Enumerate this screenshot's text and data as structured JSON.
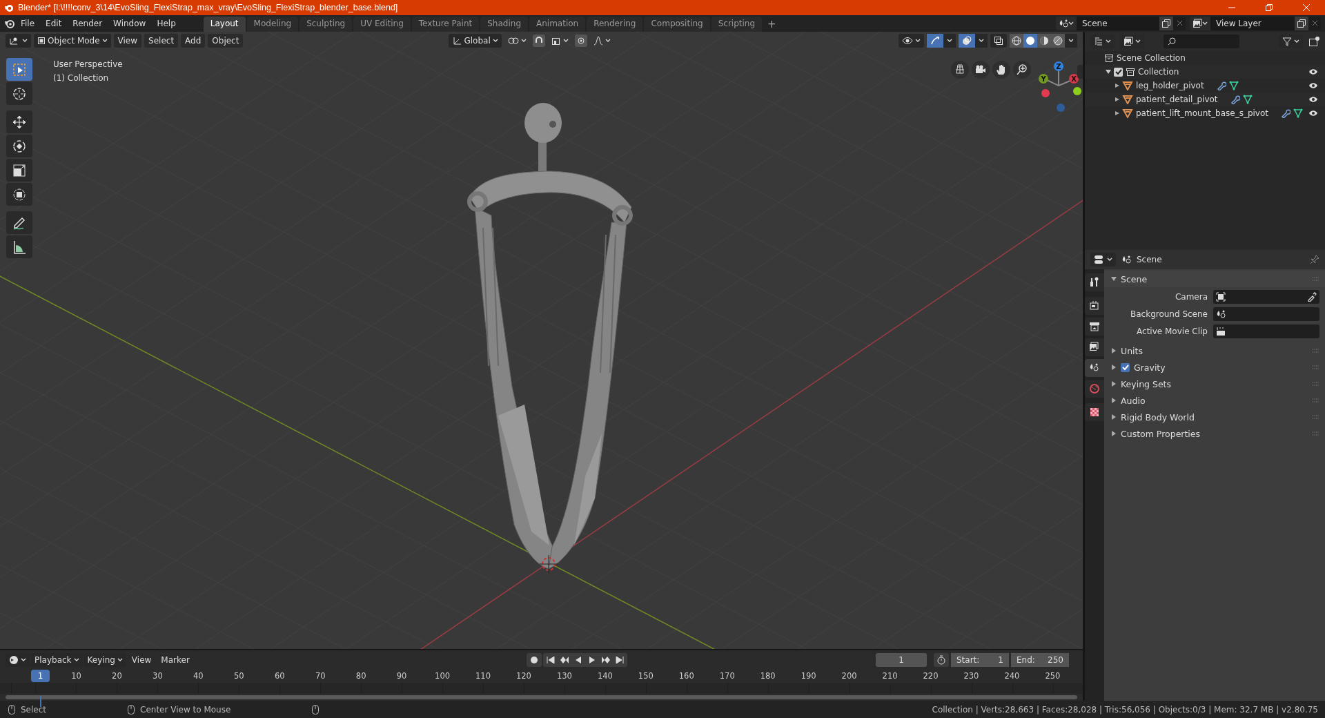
{
  "window": {
    "title": "Blender* [I:\\!!!!conv_3\\14\\EvoSling_FlexiStrap_max_vray\\EvoSling_FlexiStrap_blender_base.blend]"
  },
  "menu": [
    "File",
    "Edit",
    "Render",
    "Window",
    "Help"
  ],
  "workspaces": [
    {
      "label": "Layout",
      "selected": true
    },
    {
      "label": "Modeling",
      "selected": false
    },
    {
      "label": "Sculpting",
      "selected": false
    },
    {
      "label": "UV Editing",
      "selected": false
    },
    {
      "label": "Texture Paint",
      "selected": false
    },
    {
      "label": "Shading",
      "selected": false
    },
    {
      "label": "Animation",
      "selected": false
    },
    {
      "label": "Rendering",
      "selected": false
    },
    {
      "label": "Compositing",
      "selected": false
    },
    {
      "label": "Scripting",
      "selected": false
    }
  ],
  "add_workspace": "+",
  "scene_selector": {
    "value": "Scene"
  },
  "view_layer_selector": {
    "value": "View Layer"
  },
  "viewport": {
    "mode": "Object Mode",
    "menus": [
      "View",
      "Select",
      "Add",
      "Object"
    ],
    "orientation": "Global",
    "shading": [
      {
        "kind": "wireframe",
        "selected": false
      },
      {
        "kind": "solid",
        "selected": true
      },
      {
        "kind": "material",
        "selected": false
      },
      {
        "kind": "rendered",
        "selected": false
      }
    ],
    "overlay_text": [
      "User Perspective",
      "(1) Collection"
    ],
    "tools": [
      {
        "kind": "select",
        "selected": true
      },
      {
        "kind": "cursor",
        "selected": false
      },
      {
        "kind": "move",
        "selected": false
      },
      {
        "kind": "rotate",
        "selected": false
      },
      {
        "kind": "scale",
        "selected": false
      },
      {
        "kind": "transform",
        "selected": false
      },
      {
        "kind": "annotate",
        "selected": false
      },
      {
        "kind": "measure",
        "selected": false
      }
    ],
    "gizmo_axes": [
      "Z",
      "Y",
      "X"
    ]
  },
  "outliner": {
    "root": "Scene Collection",
    "items": [
      {
        "label": "Collection",
        "checked": true,
        "expanded": true,
        "children": [
          {
            "label": "leg_holder_pivot"
          },
          {
            "label": "patient_detail_pivot"
          },
          {
            "label": "patient_lift_mount_base_s_pivot"
          }
        ]
      }
    ]
  },
  "properties": {
    "context": "Scene",
    "tabs": [
      {
        "kind": "tool",
        "selected": false
      },
      {
        "kind": "render",
        "selected": false
      },
      {
        "kind": "output",
        "selected": false
      },
      {
        "kind": "view_layer",
        "selected": false
      },
      {
        "kind": "scene",
        "selected": true
      },
      {
        "kind": "world",
        "selected": false
      },
      {
        "kind": "texture",
        "selected": false
      }
    ],
    "panels": [
      {
        "kind": "plain",
        "label": "Scene",
        "expanded": true,
        "fields": [
          {
            "kind": "camera",
            "label": "Camera"
          },
          {
            "kind": "scene",
            "label": "Background Scene"
          },
          {
            "kind": "clip",
            "label": "Active Movie Clip"
          }
        ]
      },
      {
        "kind": "plain",
        "label": "Units",
        "expanded": false
      },
      {
        "kind": "check",
        "label": "Gravity",
        "expanded": false,
        "checked": true
      },
      {
        "kind": "plain",
        "label": "Keying Sets",
        "expanded": false
      },
      {
        "kind": "plain",
        "label": "Audio",
        "expanded": false
      },
      {
        "kind": "plain",
        "label": "Rigid Body World",
        "expanded": false
      },
      {
        "kind": "plain",
        "label": "Custom Properties",
        "expanded": false
      }
    ]
  },
  "timeline": {
    "menus": [
      {
        "label": "Playback",
        "kind": "dropdown"
      },
      {
        "label": "Keying",
        "kind": "dropdown"
      },
      {
        "label": "View",
        "kind": "plain"
      },
      {
        "label": "Marker",
        "kind": "plain"
      }
    ],
    "current_frame_indicator": "1",
    "current_frame": "1",
    "start": {
      "label": "Start:",
      "value": "1"
    },
    "end": {
      "label": "End:",
      "value": "250"
    },
    "ruler": [
      "10",
      "20",
      "30",
      "40",
      "50",
      "60",
      "70",
      "80",
      "90",
      "100",
      "110",
      "120",
      "130",
      "140",
      "150",
      "160",
      "170",
      "180",
      "190",
      "200",
      "210",
      "220",
      "230",
      "240",
      "250"
    ]
  },
  "status_bar": {
    "hints": [
      "Select",
      "Center View to Mouse"
    ],
    "stats": "Collection | Verts:28,663 | Faces:28,028 | Tris:56,056 | Objects:0/3 | Mem: 32.7 MB | v2.80.75"
  }
}
